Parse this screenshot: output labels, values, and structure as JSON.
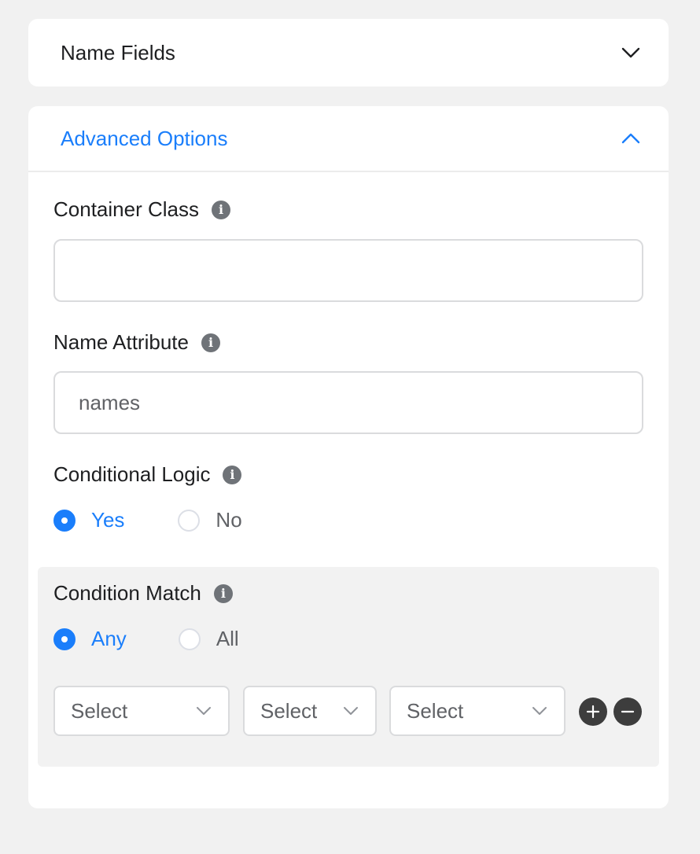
{
  "panels": {
    "name_fields": {
      "title": "Name Fields",
      "expanded": false
    },
    "advanced": {
      "title": "Advanced Options",
      "expanded": true
    }
  },
  "fields": {
    "container_class": {
      "label": "Container Class",
      "value": ""
    },
    "name_attribute": {
      "label": "Name Attribute",
      "value": "names"
    },
    "conditional_logic": {
      "label": "Conditional Logic",
      "options": [
        "Yes",
        "No"
      ],
      "selected": "Yes"
    }
  },
  "condition": {
    "label": "Condition Match",
    "options": [
      "Any",
      "All"
    ],
    "selected": "Any",
    "selects": [
      "Select",
      "Select",
      "Select"
    ]
  },
  "colors": {
    "accent": "#1a7efb",
    "background": "#f1f1f1",
    "panel": "#ffffff",
    "condition_bg": "#f2f2f2"
  },
  "icons": {
    "info": "info-icon",
    "collapsed": "chevron-down-icon",
    "expanded": "chevron-up-icon",
    "add": "plus-circle-icon",
    "remove": "minus-circle-icon"
  }
}
